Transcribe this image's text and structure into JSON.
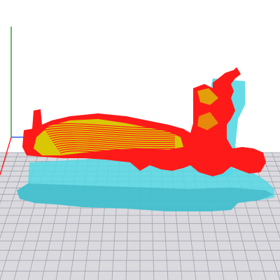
{
  "viewport": {
    "label": "",
    "background_color": "#ffffff",
    "build_plate_color": "#d9d9de",
    "grid_line_color": "#9a9aa6",
    "axis_x_color": "#ff2020",
    "axis_y_color": "#3060ff",
    "axis_z_color": "#20a020",
    "support_color": "#55d8e4",
    "model_color": "#ff1a1a",
    "top_skin_color": "#d4e600"
  },
  "model": {
    "icon": "3d-print-layer-preview"
  }
}
